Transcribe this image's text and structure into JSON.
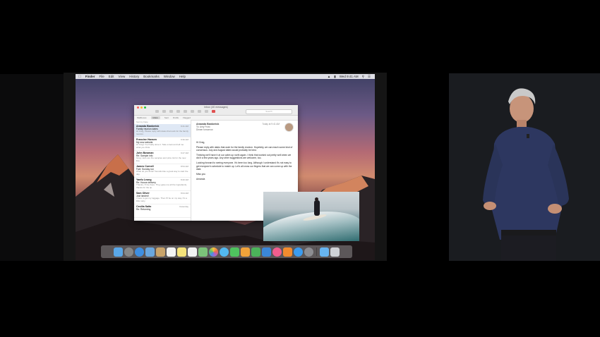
{
  "menubar": {
    "items": [
      "Finder",
      "File",
      "Edit",
      "View",
      "History",
      "Bookmarks",
      "Window",
      "Help"
    ],
    "clock": "Wed 9:41 AM"
  },
  "mail": {
    "title": "Inbox (40 messages)",
    "search_placeholder": "Search",
    "favorites": [
      "Mailboxes",
      "Inbox",
      "Sent",
      "Drafts",
      "Flagged"
    ],
    "sort_label": "Sort by Date",
    "messages": [
      {
        "from": "Amanda Bankerick",
        "date": "9:41 AM",
        "subject": "Family reunion dates",
        "preview": "Hi Greg, Please reply with dates that work for the family reunion."
      },
      {
        "from": "Francine Hansen",
        "date": "9:30 AM",
        "subject": "My new website",
        "preview": "Hi Greg! I've finally done it. Take a look and tell me what you think."
      },
      {
        "from": "John Bowman",
        "date": "9:27 AM",
        "subject": "Re: Sample info",
        "preview": "Greg, Here are the samples and price list for the new line."
      },
      {
        "from": "James Cornell",
        "date": "8:54 AM",
        "subject": "Fwd: Sunday run",
        "preview": "What do you think? Sounds like a great way to start the day."
      },
      {
        "from": "Yanfu Leung",
        "date": "8:20 AM",
        "subject": "Re: House delivery",
        "preview": "Thanks, I'll be there. They gave me all the ingredients, thanks for the tip."
      },
      {
        "from": "Sam Oliver",
        "date": "8:04 AM",
        "subject": "Just landed!",
        "preview": "I have to get my luggage. Then I'll be on my way. It's a little rainy."
      },
      {
        "from": "Cecilia Saito",
        "date": "Yesterday",
        "subject": "Re: Returning",
        "preview": ""
      }
    ],
    "reading": {
      "from": "Amanda Bankerick",
      "date": "Today at 9:41 AM",
      "to": "To: Amy Frost",
      "subject": "Dinner tomorrow",
      "greeting": "Hi Greg,",
      "p1": "Please reply with dates that work for the family reunion. Hopefully, we can reach some kind of consensus. July and August dates would probably be best.",
      "p2": "Thinking we'll have it at our cabin up north again. I think that worked out pretty well when we did it a few years ago. Any other suggestions are welcome, too.",
      "p3": "Looking forward to seeing everyone. It's been too long. Although I understand it's not easy to get everyone's schedule to match up. Let's all cross our fingers that we can come up with the date.",
      "signoff": "Miss you",
      "signature": "Amanda"
    }
  },
  "colors": {
    "accent": "#3478f6",
    "close": "#ff5f57",
    "minimize": "#febc2e",
    "zoom": "#28c840"
  },
  "dock": {
    "icons": [
      "finder-icon",
      "launchpad-icon",
      "safari-icon",
      "mail-icon",
      "contacts-icon",
      "calendar-icon",
      "notes-icon",
      "reminders-icon",
      "maps-icon",
      "photos-icon",
      "messages-icon",
      "facetime-icon",
      "pages-icon",
      "numbers-icon",
      "keynote-icon",
      "itunes-icon",
      "ibooks-icon",
      "appstore-icon",
      "preferences-icon",
      "folder-icon",
      "trash-icon"
    ]
  }
}
